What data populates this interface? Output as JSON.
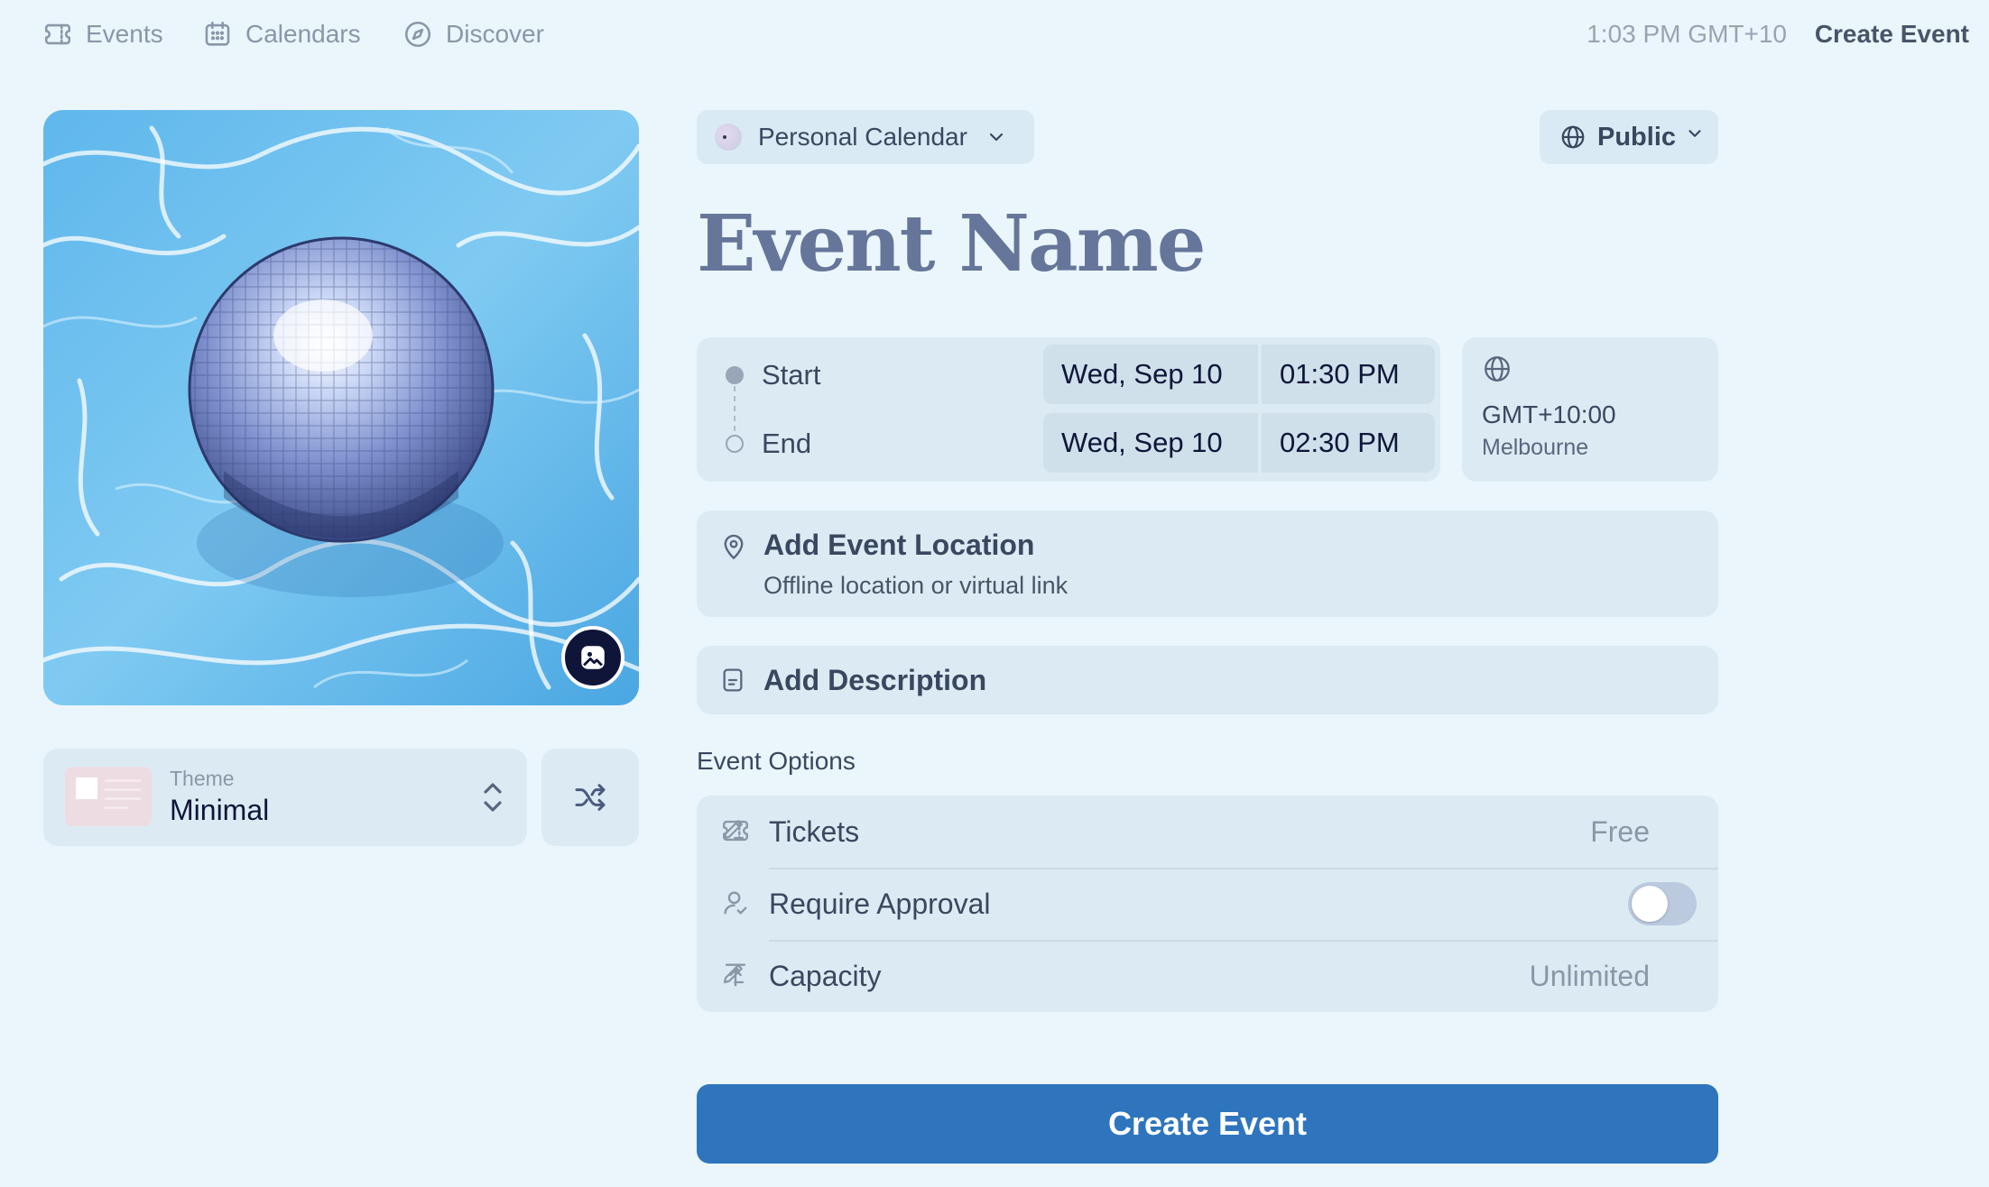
{
  "nav": {
    "events": "Events",
    "calendars": "Calendars",
    "discover": "Discover",
    "time": "1:03 PM GMT+10",
    "create_event": "Create Event"
  },
  "theme": {
    "label": "Theme",
    "value": "Minimal"
  },
  "calendar_select": {
    "label": "Personal Calendar"
  },
  "visibility": {
    "label": "Public"
  },
  "event_name": "Event Name",
  "datetime": {
    "start_label": "Start",
    "end_label": "End",
    "start_date": "Wed, Sep 10",
    "start_time": "01:30 PM",
    "end_date": "Wed, Sep 10",
    "end_time": "02:30 PM"
  },
  "timezone": {
    "offset": "GMT+10:00",
    "city": "Melbourne"
  },
  "location": {
    "title": "Add Event Location",
    "subtitle": "Offline location or virtual link"
  },
  "description": {
    "title": "Add Description"
  },
  "options": {
    "heading": "Event Options",
    "tickets_label": "Tickets",
    "tickets_value": "Free",
    "approval_label": "Require Approval",
    "approval_enabled": false,
    "capacity_label": "Capacity",
    "capacity_value": "Unlimited"
  },
  "submit": {
    "label": "Create Event"
  },
  "colors": {
    "background": "#eaf6fc",
    "panel": "#dcebf3",
    "primary_button": "#2f75bd",
    "event_name": "#66769a"
  }
}
